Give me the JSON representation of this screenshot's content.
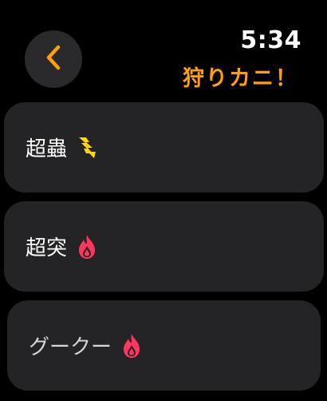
{
  "header": {
    "back_icon": "chevron-left-icon",
    "time": "5:34",
    "title": "狩りカニ！"
  },
  "list": {
    "items": [
      {
        "label": "超蟲",
        "icon": "lightning-icon",
        "icon_color": "#ffd60a"
      },
      {
        "label": "超突",
        "icon": "flame-icon",
        "icon_color": "#ff375f"
      },
      {
        "label": "グークー",
        "icon": "flame-icon",
        "icon_color": "#ff375f"
      }
    ]
  },
  "colors": {
    "background": "#000000",
    "accent": "#ff9f0a",
    "row_background": "#242426",
    "button_background": "#2a2a2c"
  }
}
